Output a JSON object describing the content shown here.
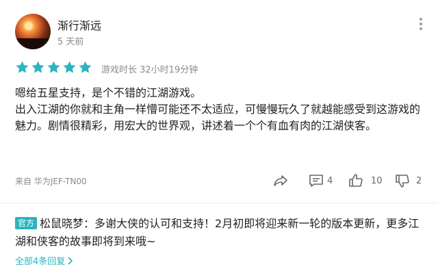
{
  "user": {
    "name": "渐行渐远",
    "time_ago": "5 天前"
  },
  "rating": {
    "stars": 5,
    "max": 5,
    "star_color": "#2ab4c0",
    "playtime": "游戏时长 32小时19分钟"
  },
  "review": {
    "paragraphs": [
      "嗯给五星支持，是个不错的江湖游戏。",
      "出入江湖的你就和主角一样懵可能还不太适应，可慢慢玩久了就越能感受到这游戏的魅力。剧情很精彩，用宏大的世界观，讲述着一个个有血有肉的江湖侠客。"
    ]
  },
  "footer": {
    "device": "来自 华为JEF-TN00",
    "comment_count": "4",
    "like_count": "10",
    "dislike_count": "2"
  },
  "reply": {
    "badge": "官方",
    "author": "松鼠晓梦：",
    "text": "多谢大侠的认可和支持！2月初即将迎来新一轮的版本更新，更多江湖和侠客的故事即将到来哦~",
    "all_replies": "全部4条回复"
  },
  "colors": {
    "accent": "#2ab4c0"
  }
}
